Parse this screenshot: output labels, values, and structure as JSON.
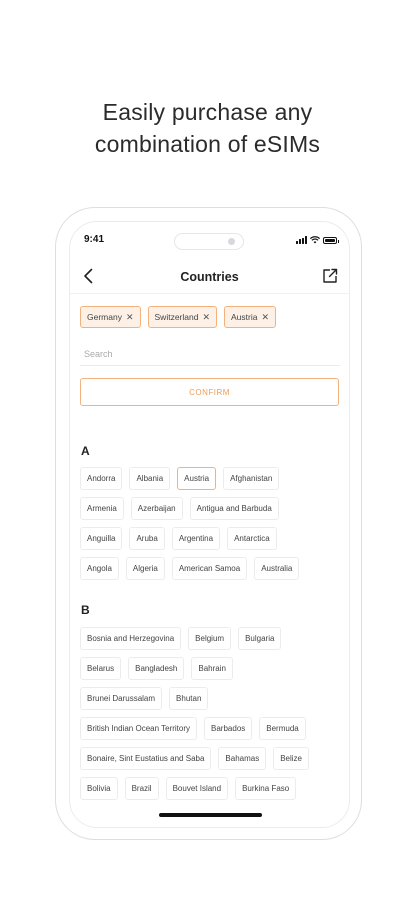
{
  "headline": {
    "line1": "Easily purchase any",
    "line2": "combination of eSIMs"
  },
  "status_bar": {
    "time": "9:41"
  },
  "nav": {
    "title": "Countries",
    "back_icon": "chevron-left-icon",
    "share_icon": "external-link-icon"
  },
  "selected_countries": [
    {
      "label": "Germany"
    },
    {
      "label": "Switzerland"
    },
    {
      "label": "Austria"
    }
  ],
  "search": {
    "placeholder": "Search",
    "value": ""
  },
  "confirm_label": "CONFIRM",
  "accent_color": "#ef9c56",
  "sections": [
    {
      "letter": "A",
      "rows": [
        [
          "Andorra",
          "Albania",
          "Austria",
          "Afghanistan"
        ],
        [
          "Armenia",
          "Azerbaijan",
          "Antigua and Barbuda"
        ],
        [
          "Anguilla",
          "Aruba",
          "Argentina",
          "Antarctica"
        ],
        [
          "Angola",
          "Algeria",
          "American Samoa",
          "Australia"
        ]
      ],
      "selected": [
        "Austria"
      ]
    },
    {
      "letter": "B",
      "rows": [
        [
          "Bosnia and Herzegovina",
          "Belgium",
          "Bulgaria"
        ],
        [
          "Belarus",
          "Bangladesh",
          "Bahrain"
        ],
        [
          "Brunei Darussalam",
          "Bhutan"
        ],
        [
          "British Indian Ocean Territory",
          "Barbados",
          "Bermuda"
        ],
        [
          "Bonaire, Sint Eustatius and Saba",
          "Bahamas",
          "Belize"
        ],
        [
          "Bolivia",
          "Brazil",
          "Bouvet Island",
          "Burkina Faso"
        ]
      ],
      "selected": []
    }
  ]
}
